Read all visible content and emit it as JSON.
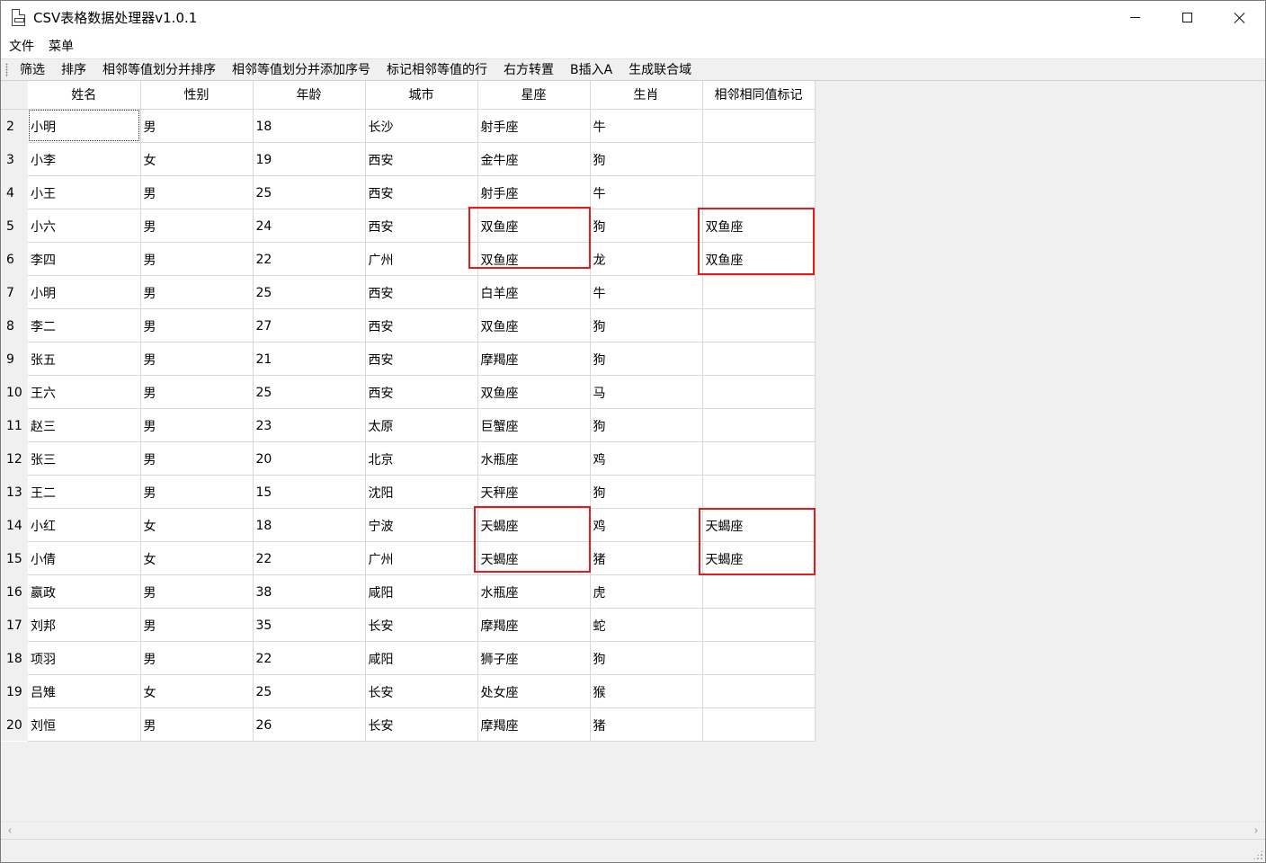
{
  "window": {
    "title": "CSV表格数据处理器v1.0.1",
    "icon": "csv-file-icon"
  },
  "menubar": {
    "items": [
      "文件",
      "菜单"
    ]
  },
  "toolbar": {
    "buttons": [
      "筛选",
      "排序",
      "相邻等值划分并排序",
      "相邻等值划分并添加序号",
      "标记相邻等值的行",
      "右方转置",
      "B插入A",
      "生成联合域"
    ]
  },
  "table": {
    "columns": [
      "姓名",
      "性别",
      "年龄",
      "城市",
      "星座",
      "生肖",
      "相邻相同值标记"
    ],
    "rows": [
      {
        "n": "2",
        "cells": [
          "小明",
          "男",
          "18",
          "长沙",
          "射手座",
          "牛",
          ""
        ]
      },
      {
        "n": "3",
        "cells": [
          "小李",
          "女",
          "19",
          "西安",
          "金牛座",
          "狗",
          ""
        ]
      },
      {
        "n": "4",
        "cells": [
          "小王",
          "男",
          "25",
          "西安",
          "射手座",
          "牛",
          ""
        ]
      },
      {
        "n": "5",
        "cells": [
          "小六",
          "男",
          "24",
          "西安",
          "双鱼座",
          "狗",
          "双鱼座"
        ]
      },
      {
        "n": "6",
        "cells": [
          "李四",
          "男",
          "22",
          "广州",
          "双鱼座",
          "龙",
          "双鱼座"
        ]
      },
      {
        "n": "7",
        "cells": [
          "小明",
          "男",
          "25",
          "西安",
          "白羊座",
          "牛",
          ""
        ]
      },
      {
        "n": "8",
        "cells": [
          "李二",
          "男",
          "27",
          "西安",
          "双鱼座",
          "狗",
          ""
        ]
      },
      {
        "n": "9",
        "cells": [
          "张五",
          "男",
          "21",
          "西安",
          "摩羯座",
          "狗",
          ""
        ]
      },
      {
        "n": "10",
        "cells": [
          "王六",
          "男",
          "25",
          "西安",
          "双鱼座",
          "马",
          ""
        ]
      },
      {
        "n": "11",
        "cells": [
          "赵三",
          "男",
          "23",
          "太原",
          "巨蟹座",
          "狗",
          ""
        ]
      },
      {
        "n": "12",
        "cells": [
          "张三",
          "男",
          "20",
          "北京",
          "水瓶座",
          "鸡",
          ""
        ]
      },
      {
        "n": "13",
        "cells": [
          "王二",
          "男",
          "15",
          "沈阳",
          "天秤座",
          "狗",
          ""
        ]
      },
      {
        "n": "14",
        "cells": [
          "小红",
          "女",
          "18",
          "宁波",
          "天蝎座",
          "鸡",
          "天蝎座"
        ]
      },
      {
        "n": "15",
        "cells": [
          "小倩",
          "女",
          "22",
          "广州",
          "天蝎座",
          "猪",
          "天蝎座"
        ]
      },
      {
        "n": "16",
        "cells": [
          "嬴政",
          "男",
          "38",
          "咸阳",
          "水瓶座",
          "虎",
          ""
        ]
      },
      {
        "n": "17",
        "cells": [
          "刘邦",
          "男",
          "35",
          "长安",
          "摩羯座",
          "蛇",
          ""
        ]
      },
      {
        "n": "18",
        "cells": [
          "项羽",
          "男",
          "22",
          "咸阳",
          "狮子座",
          "狗",
          ""
        ]
      },
      {
        "n": "19",
        "cells": [
          "吕雉",
          "女",
          "25",
          "长安",
          "处女座",
          "猴",
          ""
        ]
      },
      {
        "n": "20",
        "cells": [
          "刘恒",
          "男",
          "26",
          "长安",
          "摩羯座",
          "猪",
          ""
        ]
      }
    ]
  },
  "colors": {
    "highlight": "#e01c1c",
    "chrome": "#f0f0f0",
    "gridline": "#d8d8d8"
  }
}
